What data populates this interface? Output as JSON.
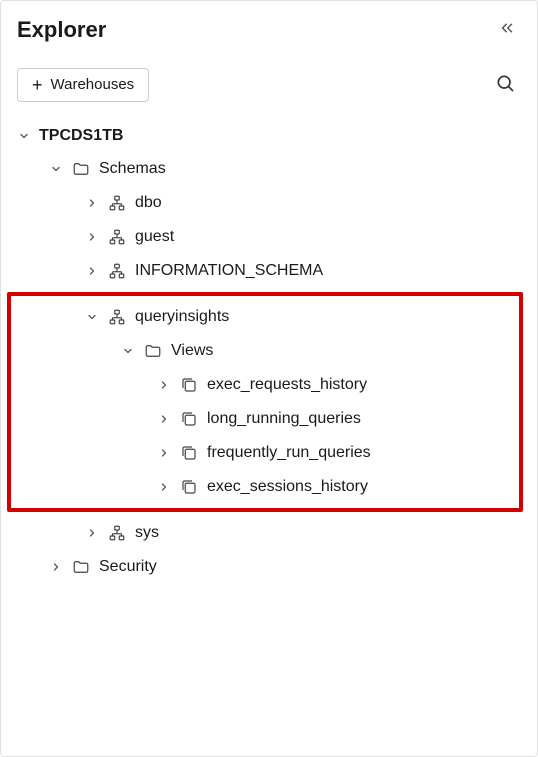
{
  "header": {
    "title": "Explorer"
  },
  "toolbar": {
    "warehouses_label": "Warehouses"
  },
  "tree": {
    "database": {
      "name": "TPCDS1TB"
    },
    "schemas_folder": "Schemas",
    "schemas": {
      "dbo": "dbo",
      "guest": "guest",
      "information_schema": "INFORMATION_SCHEMA",
      "queryinsights": "queryinsights",
      "sys": "sys"
    },
    "views_folder": "Views",
    "views": {
      "exec_requests_history": "exec_requests_history",
      "long_running_queries": "long_running_queries",
      "frequently_run_queries": "frequently_run_queries",
      "exec_sessions_history": "exec_sessions_history"
    },
    "security_folder": "Security"
  }
}
